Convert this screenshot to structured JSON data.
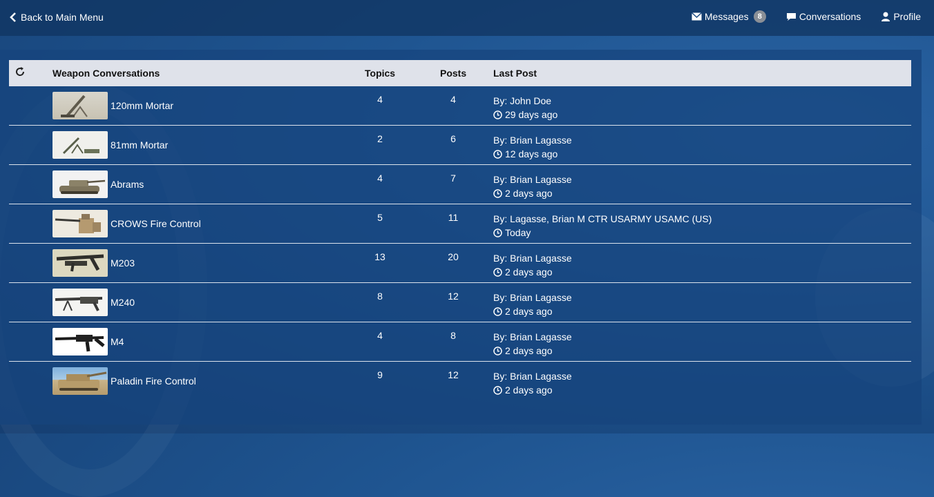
{
  "nav": {
    "back_label": "Back to Main Menu",
    "messages_label": "Messages",
    "messages_count": "8",
    "conversations_label": "Conversations",
    "profile_label": "Profile"
  },
  "table": {
    "headers": {
      "name": "Weapon Conversations",
      "topics": "Topics",
      "posts": "Posts",
      "last_post": "Last Post"
    },
    "rows": [
      {
        "name": "120mm Mortar",
        "topics": "4",
        "posts": "4",
        "by": "By: John Doe",
        "when": "29 days ago",
        "thumb": "mortar"
      },
      {
        "name": "81mm Mortar",
        "topics": "2",
        "posts": "6",
        "by": "By: Brian Lagasse",
        "when": "12 days ago",
        "thumb": "mortar-small"
      },
      {
        "name": "Abrams",
        "topics": "4",
        "posts": "7",
        "by": "By: Brian Lagasse",
        "when": "2 days ago",
        "thumb": "tank"
      },
      {
        "name": "CROWS Fire Control",
        "topics": "5",
        "posts": "11",
        "by": "By: Lagasse, Brian M CTR USARMY USAMC (US)",
        "when": "Today",
        "thumb": "turret"
      },
      {
        "name": "M203",
        "topics": "13",
        "posts": "20",
        "by": "By: Brian Lagasse",
        "when": "2 days ago",
        "thumb": "rifle-launcher"
      },
      {
        "name": "M240",
        "topics": "8",
        "posts": "12",
        "by": "By: Brian Lagasse",
        "when": "2 days ago",
        "thumb": "machine-gun"
      },
      {
        "name": "M4",
        "topics": "4",
        "posts": "8",
        "by": "By: Brian Lagasse",
        "when": "2 days ago",
        "thumb": "rifle"
      },
      {
        "name": "Paladin Fire Control",
        "topics": "9",
        "posts": "12",
        "by": "By: Brian Lagasse",
        "when": "2 days ago",
        "thumb": "howitzer"
      }
    ]
  }
}
